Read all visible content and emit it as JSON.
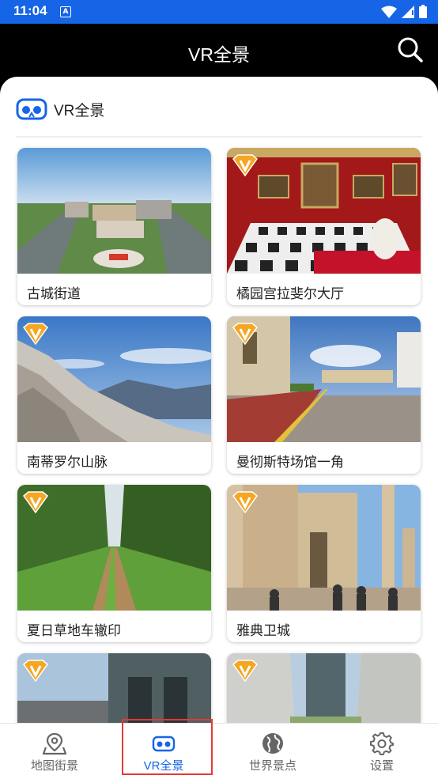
{
  "status_bar": {
    "time": "11:04",
    "notification": "A"
  },
  "header": {
    "title": "VR全景"
  },
  "section": {
    "title": "VR全景"
  },
  "items": [
    {
      "label": "古城街道",
      "vip": false
    },
    {
      "label": "橘园宫拉斐尔大厅",
      "vip": true
    },
    {
      "label": "南蒂罗尔山脉",
      "vip": true
    },
    {
      "label": "曼彻斯特场馆一角",
      "vip": true
    },
    {
      "label": "夏日草地车辙印",
      "vip": true
    },
    {
      "label": "雅典卫城",
      "vip": true
    },
    {
      "label": "",
      "vip": true
    },
    {
      "label": "",
      "vip": true
    }
  ],
  "nav": [
    {
      "label": "地图街景",
      "icon": "map-pin-icon",
      "active": false
    },
    {
      "label": "VR全景",
      "icon": "vr-headset-icon",
      "active": true
    },
    {
      "label": "世界景点",
      "icon": "globe-icon",
      "active": false
    },
    {
      "label": "设置",
      "icon": "gear-icon",
      "active": false
    }
  ],
  "colors": {
    "accent": "#1565E6",
    "vip_badge": "#F5A623",
    "highlight_box": "#E53935"
  }
}
